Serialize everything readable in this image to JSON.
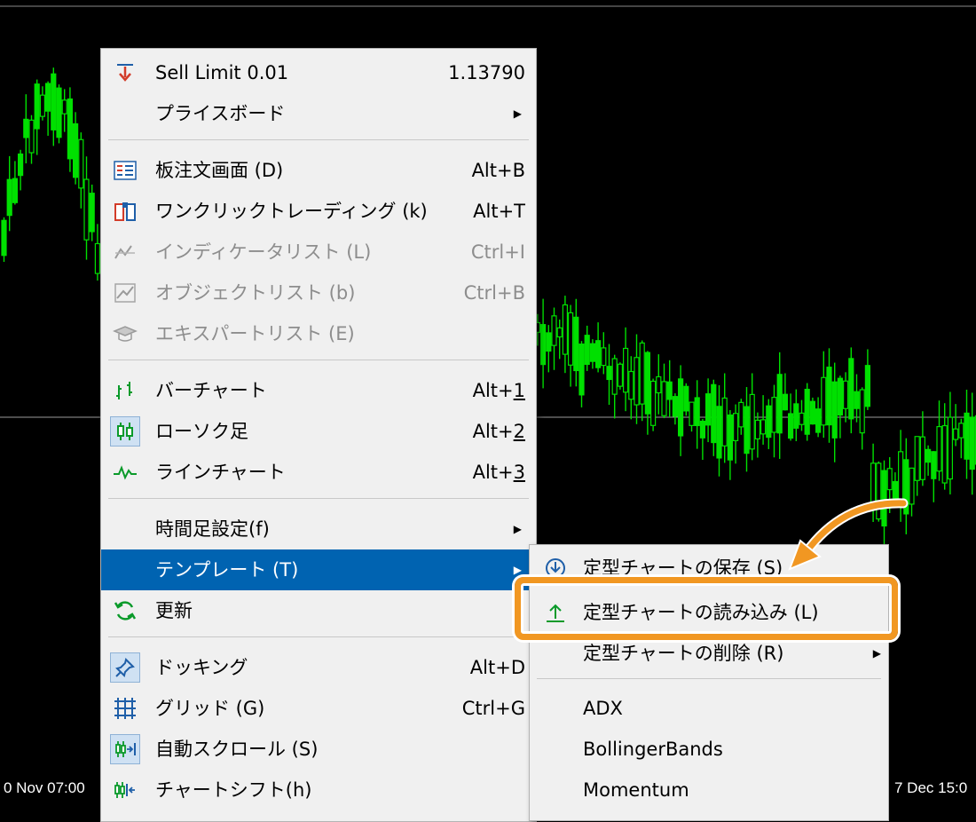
{
  "timeline": {
    "left_label": "0 Nov 07:00",
    "right_label": "7 Dec 15:0"
  },
  "context_menu": {
    "sell_limit": {
      "label": "Sell Limit 0.01",
      "price": "1.13790"
    },
    "price_board": {
      "label": "プライスボード"
    },
    "order_screen": {
      "label": "板注文画面 (D)",
      "shortcut": "Alt+B"
    },
    "one_click": {
      "label": "ワンクリックトレーディング (k)",
      "shortcut": "Alt+T"
    },
    "indicator_list": {
      "label": "インディケータリスト (L)",
      "shortcut": "Ctrl+I"
    },
    "object_list": {
      "label": "オブジェクトリスト (b)",
      "shortcut": "Ctrl+B"
    },
    "expert_list": {
      "label": "エキスパートリスト (E)"
    },
    "bar_chart": {
      "label": "バーチャート",
      "shortcut_prefix": "Alt+",
      "shortcut_key": "1"
    },
    "candlestick": {
      "label": "ローソク足",
      "shortcut_prefix": "Alt+",
      "shortcut_key": "2"
    },
    "line_chart": {
      "label": "ラインチャート",
      "shortcut_prefix": "Alt+",
      "shortcut_key": "3"
    },
    "timeframe": {
      "label": "時間足設定(f)"
    },
    "template": {
      "label": "テンプレート (T)"
    },
    "refresh": {
      "label": "更新"
    },
    "docking": {
      "label": "ドッキング",
      "shortcut": "Alt+D"
    },
    "grid": {
      "label": "グリッド (G)",
      "shortcut": "Ctrl+G"
    },
    "autoscroll": {
      "label": "自動スクロール (S)"
    },
    "chart_shift": {
      "label": "チャートシフト(h)"
    }
  },
  "template_submenu": {
    "save": {
      "label": "定型チャートの保存 (S)"
    },
    "load": {
      "label": "定型チャートの読み込み (L)"
    },
    "delete": {
      "label": "定型チャートの削除 (R)"
    },
    "templates": [
      "ADX",
      "BollingerBands",
      "Momentum"
    ]
  },
  "colors": {
    "candle": "#00e000",
    "selected": "#0063b1",
    "highlight": "#f19722"
  }
}
